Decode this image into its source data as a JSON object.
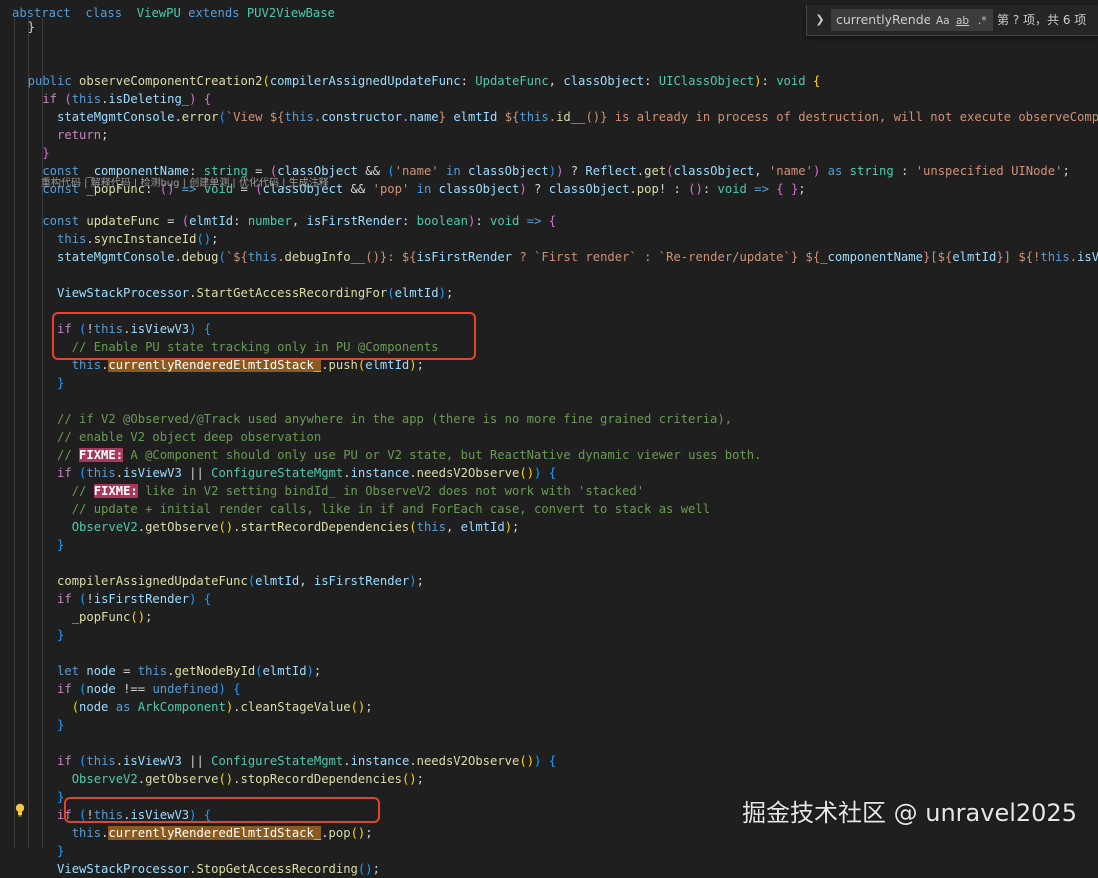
{
  "codelens": "重构代码 | 解释代码 | 检测bug | 创建单测 | 优化代码 | 生成注释",
  "find_widget": {
    "toggle_icon": "chevron-right-icon",
    "query": "currentlyRende",
    "match_case_label": "Aa",
    "whole_word_label": "ab",
    "regex_label": ".*",
    "result_count": "第 ? 项，共 6 项"
  },
  "watermark": "掘金技术社区 @ unravel2025",
  "colors": {
    "background": "#1f1f1f",
    "search_highlight": "#8a5a1e",
    "annotation_box": "#e8412c",
    "fixme_badge": "#a8385e"
  },
  "annotations": [
    "push-highlight-box",
    "pop-highlight-box"
  ],
  "lines": [
    [
      [
        "kw",
        "abstract"
      ],
      [
        "",
        "  "
      ],
      [
        "kw",
        "class"
      ],
      [
        "",
        "  "
      ],
      [
        "ty",
        "ViewPU"
      ],
      [
        "",
        ""
      ],
      [
        "kw",
        " extends "
      ],
      [
        "ty",
        "PUV2ViewBase"
      ]
    ],
    [
      [
        "pun",
        "  }"
      ]
    ],
    [],
    [
      [
        "kw",
        "  public "
      ],
      [
        "fn",
        "observeComponentCreation2"
      ],
      [
        "br1",
        "("
      ],
      [
        "var",
        "compilerAssignedUpdateFunc"
      ],
      [
        "pun",
        ": "
      ],
      [
        "ty",
        "UpdateFunc"
      ],
      [
        "pun",
        ", "
      ],
      [
        "var",
        "classObject"
      ],
      [
        "pun",
        ": "
      ],
      [
        "ty",
        "UIClassObject"
      ],
      [
        "br1",
        ")"
      ],
      [
        "pun",
        ": "
      ],
      [
        "ty",
        "void"
      ],
      [
        "pun",
        " "
      ],
      [
        "br1",
        "{"
      ]
    ],
    [
      [
        "ctl",
        "    if "
      ],
      [
        "br2",
        "("
      ],
      [
        "kw",
        "this"
      ],
      [
        "pun",
        "."
      ],
      [
        "var",
        "isDeleting_"
      ],
      [
        "br2",
        ")"
      ],
      [
        "pun",
        " "
      ],
      [
        "br2",
        "{"
      ]
    ],
    [
      [
        "var",
        "      stateMgmtConsole"
      ],
      [
        "pun",
        "."
      ],
      [
        "fn",
        "error"
      ],
      [
        "br3",
        "("
      ],
      [
        "str",
        "`View ${"
      ],
      [
        "kw",
        "this"
      ],
      [
        "str",
        "."
      ],
      [
        "var",
        "constructor"
      ],
      [
        "str",
        "."
      ],
      [
        "var",
        "name"
      ],
      [
        "str",
        "} "
      ],
      [
        "var",
        "elmtId"
      ],
      [
        "str",
        " ${"
      ],
      [
        "kw",
        "this"
      ],
      [
        "str",
        "."
      ],
      [
        "fn",
        "id__"
      ],
      [
        "str",
        "()} is already in process of destruction, will not execute observeComponen"
      ]
    ],
    [
      [
        "ctl",
        "      return"
      ],
      [
        "pun",
        ";"
      ]
    ],
    [
      [
        "br2",
        "    }"
      ]
    ],
    [
      [
        "kw",
        "    const "
      ],
      [
        "var",
        "_componentName"
      ],
      [
        "pun",
        ": "
      ],
      [
        "ty",
        "string"
      ],
      [
        "pun",
        " = "
      ],
      [
        "br2",
        "("
      ],
      [
        "var",
        "classObject"
      ],
      [
        "pun",
        " && "
      ],
      [
        "br3",
        "("
      ],
      [
        "str",
        "'name'"
      ],
      [
        "kw",
        " in "
      ],
      [
        "var",
        "classObject"
      ],
      [
        "br3",
        ")"
      ],
      [
        "br2",
        ")"
      ],
      [
        "pun",
        " ? "
      ],
      [
        "var",
        "Reflect"
      ],
      [
        "pun",
        "."
      ],
      [
        "fn",
        "get"
      ],
      [
        "br2",
        "("
      ],
      [
        "var",
        "classObject"
      ],
      [
        "pun",
        ", "
      ],
      [
        "str",
        "'name'"
      ],
      [
        "br2",
        ")"
      ],
      [
        "kw",
        " as "
      ],
      [
        "ty",
        "string"
      ],
      [
        "pun",
        " : "
      ],
      [
        "str",
        "'unspecified UINode'"
      ],
      [
        "pun",
        ";"
      ]
    ],
    [
      [
        "kw",
        "    const "
      ],
      [
        "fn",
        "_popFunc"
      ],
      [
        "pun",
        ": "
      ],
      [
        "br2",
        "()"
      ],
      [
        "kw",
        " => "
      ],
      [
        "ty",
        "void"
      ],
      [
        "pun",
        " = "
      ],
      [
        "br2",
        "("
      ],
      [
        "var",
        "classObject"
      ],
      [
        "pun",
        " && "
      ],
      [
        "str",
        "'pop'"
      ],
      [
        "kw",
        " in "
      ],
      [
        "var",
        "classObject"
      ],
      [
        "br2",
        ")"
      ],
      [
        "pun",
        " ? "
      ],
      [
        "var",
        "classObject"
      ],
      [
        "pun",
        "."
      ],
      [
        "fn",
        "pop"
      ],
      [
        "pun",
        "! : "
      ],
      [
        "br2",
        "()"
      ],
      [
        "pun",
        ": "
      ],
      [
        "ty",
        "void"
      ],
      [
        "kw",
        " => "
      ],
      [
        "br2",
        "{ }"
      ],
      [
        "pun",
        ";"
      ]
    ],
    [
      [
        "kw",
        "    const "
      ],
      [
        "fn",
        "updateFunc"
      ],
      [
        "pun",
        " = "
      ],
      [
        "br2",
        "("
      ],
      [
        "var",
        "elmtId"
      ],
      [
        "pun",
        ": "
      ],
      [
        "ty",
        "number"
      ],
      [
        "pun",
        ", "
      ],
      [
        "var",
        "isFirstRender"
      ],
      [
        "pun",
        ": "
      ],
      [
        "ty",
        "boolean"
      ],
      [
        "br2",
        ")"
      ],
      [
        "pun",
        ": "
      ],
      [
        "ty",
        "void"
      ],
      [
        "kw",
        " => "
      ],
      [
        "br2",
        "{"
      ]
    ],
    [
      [
        "kw",
        "      this"
      ],
      [
        "pun",
        "."
      ],
      [
        "fn",
        "syncInstanceId"
      ],
      [
        "br3",
        "()"
      ],
      [
        "pun",
        ";"
      ]
    ],
    [
      [
        "var",
        "      stateMgmtConsole"
      ],
      [
        "pun",
        "."
      ],
      [
        "fn",
        "debug"
      ],
      [
        "br3",
        "("
      ],
      [
        "str",
        "`${"
      ],
      [
        "kw",
        "this"
      ],
      [
        "str",
        "."
      ],
      [
        "fn",
        "debugInfo__"
      ],
      [
        "str",
        "()}: ${"
      ],
      [
        "var",
        "isFirstRender"
      ],
      [
        "str",
        " ? "
      ],
      [
        "str",
        "`First render`"
      ],
      [
        "str",
        " : "
      ],
      [
        "str",
        "`Re-render/update`"
      ],
      [
        "str",
        "} ${"
      ],
      [
        "var",
        "_componentName"
      ],
      [
        "str",
        "}[${"
      ],
      [
        "var",
        "elmtId"
      ],
      [
        "str",
        "}] ${!"
      ],
      [
        "kw",
        "this"
      ],
      [
        "str",
        "."
      ],
      [
        "var",
        "isView"
      ]
    ],
    [],
    [
      [
        "var",
        "      ViewStackProcessor"
      ],
      [
        "pun",
        "."
      ],
      [
        "fn",
        "StartGetAccessRecordingFor"
      ],
      [
        "br3",
        "("
      ],
      [
        "var",
        "elmtId"
      ],
      [
        "br3",
        ")"
      ],
      [
        "pun",
        ";"
      ]
    ],
    [],
    [
      [
        "ctl",
        "      if "
      ],
      [
        "br3",
        "("
      ],
      [
        "pun",
        "!"
      ],
      [
        "kw",
        "this"
      ],
      [
        "pun",
        "."
      ],
      [
        "var",
        "isViewV3"
      ],
      [
        "br3",
        ")"
      ],
      [
        "pun",
        " "
      ],
      [
        "br3",
        "{"
      ]
    ],
    [
      [
        "cm",
        "        // Enable PU state tracking only in PU @Components"
      ]
    ],
    [
      [
        "kw",
        "        this"
      ],
      [
        "pun",
        "."
      ],
      [
        "match",
        "currentlyRenderedElmtIdStack_"
      ],
      [
        "pun",
        "."
      ],
      [
        "fn",
        "push"
      ],
      [
        "br1",
        "("
      ],
      [
        "var",
        "elmtId"
      ],
      [
        "br1",
        ")"
      ],
      [
        "pun",
        ";"
      ]
    ],
    [
      [
        "br3",
        "      }"
      ]
    ],
    [],
    [
      [
        "cm",
        "      // if V2 @Observed/@Track used anywhere in the app (there is no more fine grained criteria),"
      ]
    ],
    [
      [
        "cm",
        "      // enable V2 object deep observation"
      ]
    ],
    [
      [
        "cm",
        "      // "
      ],
      [
        "fixme",
        "FIXME:"
      ],
      [
        "cm",
        " A @Component should only use PU or V2 state, but ReactNative dynamic viewer uses both."
      ]
    ],
    [
      [
        "ctl",
        "      if "
      ],
      [
        "br3",
        "("
      ],
      [
        "kw",
        "this"
      ],
      [
        "pun",
        "."
      ],
      [
        "var",
        "isViewV3"
      ],
      [
        "pun",
        " || "
      ],
      [
        "ty",
        "ConfigureStateMgmt"
      ],
      [
        "pun",
        "."
      ],
      [
        "var",
        "instance"
      ],
      [
        "pun",
        "."
      ],
      [
        "fn",
        "needsV2Observe"
      ],
      [
        "br1",
        "()"
      ],
      [
        "br3",
        ")"
      ],
      [
        "pun",
        " "
      ],
      [
        "br3",
        "{"
      ]
    ],
    [
      [
        "cm",
        "        // "
      ],
      [
        "fixme",
        "FIXME:"
      ],
      [
        "cm",
        " like in V2 setting bindId_ in ObserveV2 does not work with 'stacked'"
      ]
    ],
    [
      [
        "cm",
        "        // update + initial render calls, like in if and ForEach case, convert to stack as well"
      ]
    ],
    [
      [
        "ty",
        "        ObserveV2"
      ],
      [
        "pun",
        "."
      ],
      [
        "fn",
        "getObserve"
      ],
      [
        "br1",
        "()"
      ],
      [
        "pun",
        "."
      ],
      [
        "fn",
        "startRecordDependencies"
      ],
      [
        "br1",
        "("
      ],
      [
        "kw",
        "this"
      ],
      [
        "pun",
        ", "
      ],
      [
        "var",
        "elmtId"
      ],
      [
        "br1",
        ")"
      ],
      [
        "pun",
        ";"
      ]
    ],
    [
      [
        "br3",
        "      }"
      ]
    ],
    [],
    [
      [
        "fn",
        "      compilerAssignedUpdateFunc"
      ],
      [
        "br3",
        "("
      ],
      [
        "var",
        "elmtId"
      ],
      [
        "pun",
        ", "
      ],
      [
        "var",
        "isFirstRender"
      ],
      [
        "br3",
        ")"
      ],
      [
        "pun",
        ";"
      ]
    ],
    [
      [
        "ctl",
        "      if "
      ],
      [
        "br3",
        "("
      ],
      [
        "pun",
        "!"
      ],
      [
        "var",
        "isFirstRender"
      ],
      [
        "br3",
        ")"
      ],
      [
        "pun",
        " "
      ],
      [
        "br3",
        "{"
      ]
    ],
    [
      [
        "fn",
        "        _popFunc"
      ],
      [
        "br1",
        "()"
      ],
      [
        "pun",
        ";"
      ]
    ],
    [
      [
        "br3",
        "      }"
      ]
    ],
    [],
    [
      [
        "kw",
        "      let "
      ],
      [
        "var",
        "node"
      ],
      [
        "pun",
        " = "
      ],
      [
        "kw",
        "this"
      ],
      [
        "pun",
        "."
      ],
      [
        "fn",
        "getNodeById"
      ],
      [
        "br3",
        "("
      ],
      [
        "var",
        "elmtId"
      ],
      [
        "br3",
        ")"
      ],
      [
        "pun",
        ";"
      ]
    ],
    [
      [
        "ctl",
        "      if "
      ],
      [
        "br3",
        "("
      ],
      [
        "var",
        "node"
      ],
      [
        "pun",
        " !== "
      ],
      [
        "kw",
        "undefined"
      ],
      [
        "br3",
        ")"
      ],
      [
        "pun",
        " "
      ],
      [
        "br3",
        "{"
      ]
    ],
    [
      [
        "br1",
        "        ("
      ],
      [
        "var",
        "node"
      ],
      [
        "kw",
        " as "
      ],
      [
        "ty",
        "ArkComponent"
      ],
      [
        "br1",
        ")"
      ],
      [
        "pun",
        "."
      ],
      [
        "fn",
        "cleanStageValue"
      ],
      [
        "br1",
        "()"
      ],
      [
        "pun",
        ";"
      ]
    ],
    [
      [
        "br3",
        "      }"
      ]
    ],
    [],
    [
      [
        "ctl",
        "      if "
      ],
      [
        "br3",
        "("
      ],
      [
        "kw",
        "this"
      ],
      [
        "pun",
        "."
      ],
      [
        "var",
        "isViewV3"
      ],
      [
        "pun",
        " || "
      ],
      [
        "ty",
        "ConfigureStateMgmt"
      ],
      [
        "pun",
        "."
      ],
      [
        "var",
        "instance"
      ],
      [
        "pun",
        "."
      ],
      [
        "fn",
        "needsV2Observe"
      ],
      [
        "br1",
        "()"
      ],
      [
        "br3",
        ")"
      ],
      [
        "pun",
        " "
      ],
      [
        "br3",
        "{"
      ]
    ],
    [
      [
        "ty",
        "        ObserveV2"
      ],
      [
        "pun",
        "."
      ],
      [
        "fn",
        "getObserve"
      ],
      [
        "br1",
        "()"
      ],
      [
        "pun",
        "."
      ],
      [
        "fn",
        "stopRecordDependencies"
      ],
      [
        "br1",
        "()"
      ],
      [
        "pun",
        ";"
      ]
    ],
    [
      [
        "br3",
        "      }"
      ]
    ],
    [
      [
        "ctl",
        "      if "
      ],
      [
        "br3",
        "("
      ],
      [
        "pun",
        "!"
      ],
      [
        "kw",
        "this"
      ],
      [
        "pun",
        "."
      ],
      [
        "var",
        "isViewV3"
      ],
      [
        "br3",
        ")"
      ],
      [
        "pun",
        " "
      ],
      [
        "br3",
        "{"
      ]
    ],
    [
      [
        "kw",
        "        this"
      ],
      [
        "pun",
        "."
      ],
      [
        "match",
        "currentlyRenderedElmtIdStack_"
      ],
      [
        "pun",
        "."
      ],
      [
        "fn",
        "pop"
      ],
      [
        "br1",
        "()"
      ],
      [
        "pun",
        ";"
      ]
    ],
    [
      [
        "br3",
        "      }"
      ]
    ],
    [
      [
        "var",
        "      ViewStackProcessor"
      ],
      [
        "pun",
        "."
      ],
      [
        "fn",
        "StopGetAccessRecording"
      ],
      [
        "br3",
        "()"
      ],
      [
        "pun",
        ";"
      ]
    ]
  ]
}
